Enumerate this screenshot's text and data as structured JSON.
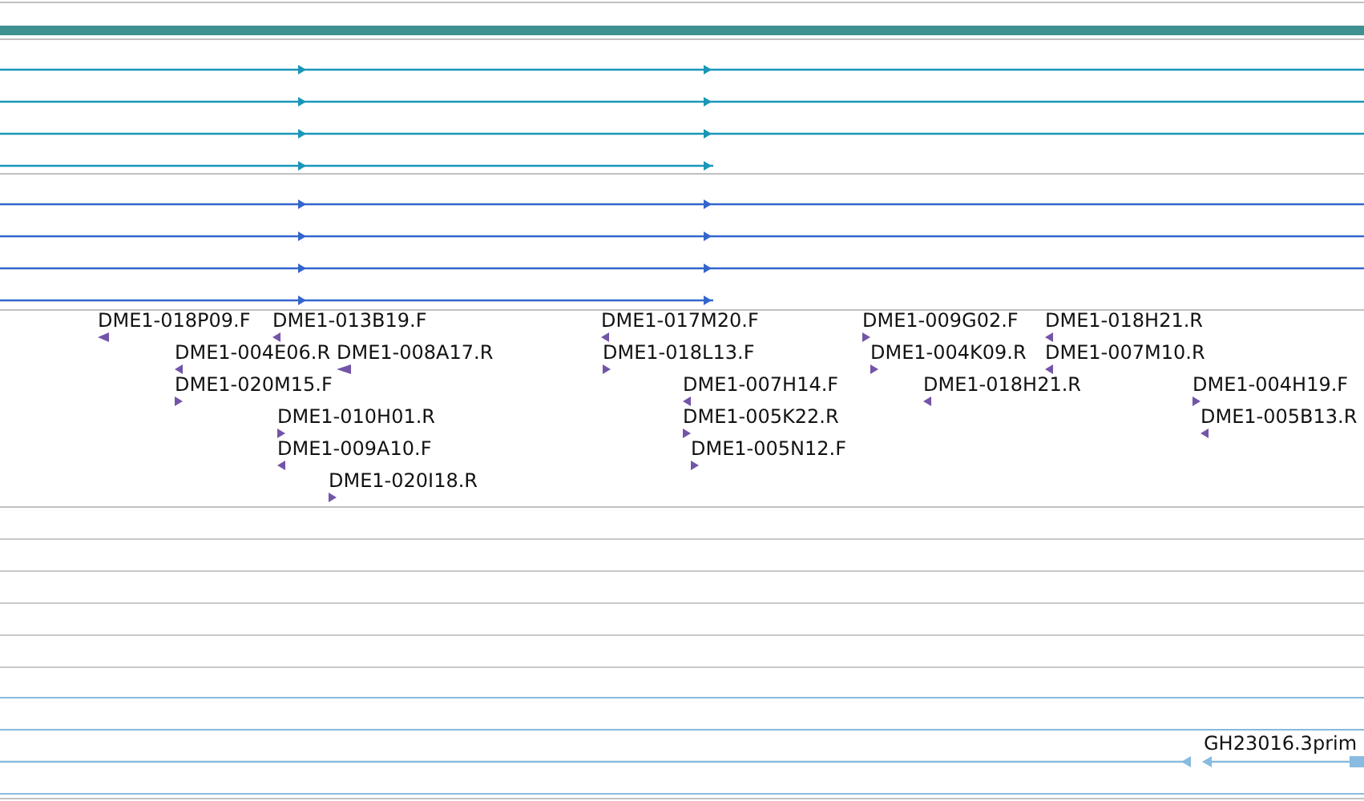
{
  "summary_bar": {
    "color": "#3f9090"
  },
  "read_groups": [
    {
      "color": "#1a96b8",
      "reads": [
        {
          "forward": true
        },
        {
          "forward": true
        },
        {
          "forward": true
        },
        {
          "forward": true
        }
      ]
    },
    {
      "color": "#3366cc",
      "reads": [
        {
          "forward": true
        },
        {
          "forward": true
        },
        {
          "forward": true
        },
        {
          "forward": true
        }
      ]
    }
  ],
  "features": [
    {
      "label": "DME1-018P09.F",
      "forward": false
    },
    {
      "label": "DME1-013B19.F",
      "forward": false
    },
    {
      "label": "DME1-004E06.R",
      "forward": false
    },
    {
      "label": "DME1-008A17.R",
      "forward": false
    },
    {
      "label": "DME1-020M15.F",
      "forward": true
    },
    {
      "label": "DME1-010H01.R",
      "forward": true
    },
    {
      "label": "DME1-009A10.F",
      "forward": false
    },
    {
      "label": "DME1-020I18.R",
      "forward": true
    },
    {
      "label": "DME1-017M20.F",
      "forward": false
    },
    {
      "label": "DME1-018L13.F",
      "forward": true
    },
    {
      "label": "DME1-007H14.F",
      "forward": false
    },
    {
      "label": "DME1-005K22.R",
      "forward": true
    },
    {
      "label": "DME1-005N12.F",
      "forward": true
    },
    {
      "label": "DME1-009G02.F",
      "forward": true
    },
    {
      "label": "DME1-004K09.R",
      "forward": true
    },
    {
      "label": "DME1-018H21.R",
      "forward": false
    },
    {
      "label": "DME1-018H21.R",
      "forward": false
    },
    {
      "label": "DME1-007M10.R",
      "forward": false
    },
    {
      "label": "DME1-004H19.F",
      "forward": true
    },
    {
      "label": "DME1-005B13.R",
      "forward": false
    }
  ],
  "transcript": {
    "label": "GH23016.3prim",
    "forward": false,
    "color": "#88bbe0"
  }
}
